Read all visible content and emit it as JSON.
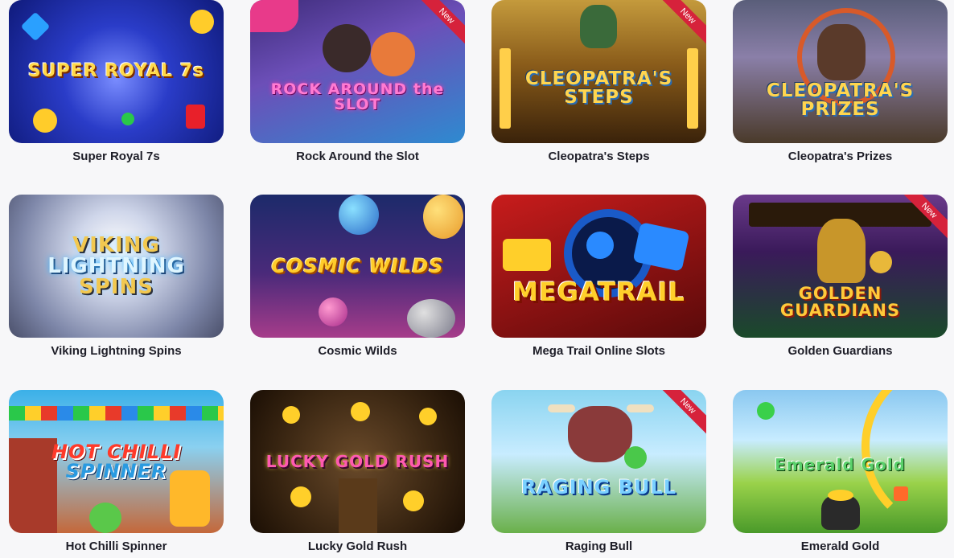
{
  "ribbon_label": "New",
  "games": [
    {
      "id": "super-royal-7s",
      "title": "Super Royal 7s",
      "art_text": "SUPER ROYAL 7s",
      "is_new": false
    },
    {
      "id": "rock-around-the-slot",
      "title": "Rock Around the Slot",
      "art_text": "ROCK AROUND the SLOT",
      "is_new": true
    },
    {
      "id": "cleopatras-steps",
      "title": "Cleopatra's Steps",
      "art_text": "CLEOPATRA'S STEPS",
      "is_new": true
    },
    {
      "id": "cleopatras-prizes",
      "title": "Cleopatra's Prizes",
      "art_text": "CLEOPATRA'S PRIZES",
      "is_new": false
    },
    {
      "id": "viking-lightning-spins",
      "title": "Viking Lightning Spins",
      "art_text_1": "VIKING",
      "art_text_2": "LIGHTNING",
      "art_text_3": "SPINS",
      "is_new": false
    },
    {
      "id": "cosmic-wilds",
      "title": "Cosmic Wilds",
      "art_text": "COSMIC WILDS",
      "is_new": false
    },
    {
      "id": "mega-trail",
      "title": "Mega Trail Online Slots",
      "art_text": "MEGATRAIL",
      "is_new": false
    },
    {
      "id": "golden-guardians",
      "title": "Golden Guardians",
      "art_text": "GOLDEN GUARDIANS",
      "is_new": true
    },
    {
      "id": "hot-chilli-spinner",
      "title": "Hot Chilli Spinner",
      "art_text_1": "HOT CHILLI",
      "art_text_2": "SPINNER",
      "is_new": false
    },
    {
      "id": "lucky-gold-rush",
      "title": "Lucky Gold Rush",
      "art_text": "LUCKY GOLD RUSH",
      "is_new": false
    },
    {
      "id": "raging-bull",
      "title": "Raging Bull",
      "art_text": "RAGING BULL",
      "is_new": true
    },
    {
      "id": "emerald-gold",
      "title": "Emerald Gold",
      "art_text": "Emerald Gold",
      "is_new": false
    }
  ],
  "colors": {
    "background": "#f7f7f9",
    "title_text": "#1e1e28",
    "ribbon": "#d6223b"
  }
}
